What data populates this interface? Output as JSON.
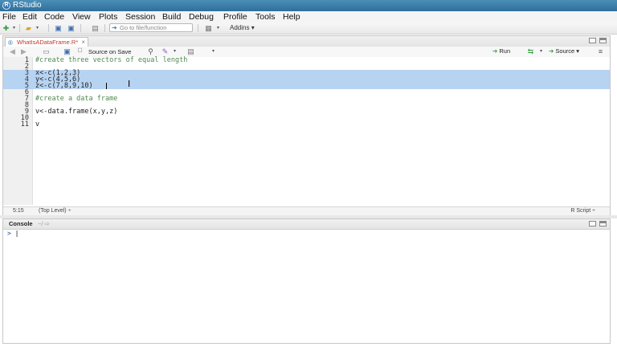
{
  "window": {
    "title": "RStudio"
  },
  "menu": [
    "File",
    "Edit",
    "Code",
    "View",
    "Plots",
    "Session",
    "Build",
    "Debug",
    "Profile",
    "Tools",
    "Help"
  ],
  "toolbar": {
    "goto_placeholder": "Go to file/function",
    "addins_label": "Addins"
  },
  "editor": {
    "tab_label": "WhatIsADataFrame.R*",
    "tab_close": "×",
    "source_on_save_label": "Source on Save",
    "run_label": "Run",
    "source_label": "Source",
    "lines": [
      {
        "n": "1",
        "code": "#create three vectors of equal length"
      },
      {
        "n": "2",
        "code": ""
      },
      {
        "n": "3",
        "code": "x<-c(1,2,3)"
      },
      {
        "n": "4",
        "code": "y<-c(4,5,6)"
      },
      {
        "n": "5",
        "code": "z<-c(7,8,9,10)"
      },
      {
        "n": "6",
        "code": ""
      },
      {
        "n": "7",
        "code": "#create a data frame"
      },
      {
        "n": "8",
        "code": ""
      },
      {
        "n": "9",
        "code": "v<-data.frame(x,y,z)"
      },
      {
        "n": "10",
        "code": ""
      },
      {
        "n": "11",
        "code": "v"
      }
    ],
    "status": {
      "position": "5:15",
      "scope": "(Top Level) ÷",
      "filetype": "R Script ÷"
    }
  },
  "console": {
    "title": "Console",
    "path": "~/ ⇨",
    "prompt": ">"
  }
}
